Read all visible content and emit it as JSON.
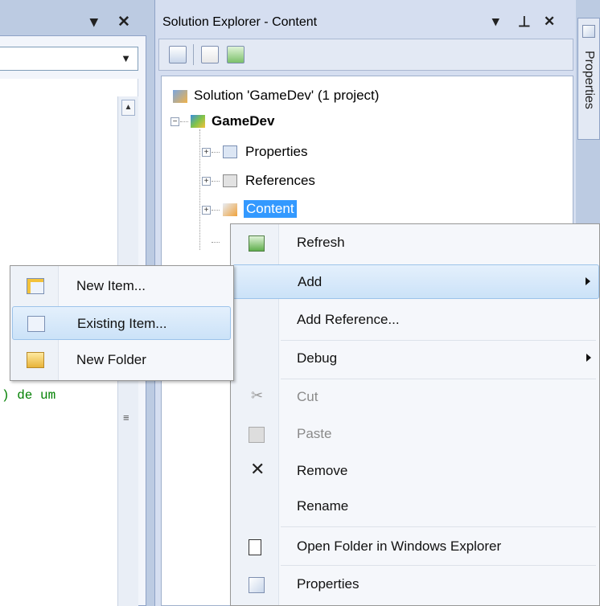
{
  "left_panel": {
    "dropdown_icon": "chevron-down-icon",
    "close_icon": "close-icon",
    "code_fragment": ") de um"
  },
  "solution_explorer": {
    "title": "Solution Explorer - Content",
    "toolbar": [
      "properties-icon",
      "show-all-files-icon",
      "refresh-icon"
    ],
    "tree": {
      "solution": "Solution 'GameDev' (1 project)",
      "project": "GameDev",
      "children": [
        "Properties",
        "References",
        "Content"
      ],
      "selected": "Content"
    }
  },
  "properties_tab": {
    "label": "Properties"
  },
  "context_menu": {
    "items": [
      {
        "label": "Refresh",
        "icon": "refresh-icon",
        "enabled": true
      },
      {
        "label": "Add",
        "submenu": true,
        "highlighted": true
      },
      {
        "label": "Add Reference..."
      },
      {
        "label": "Debug",
        "submenu": true
      },
      {
        "label": "Cut",
        "icon": "cut-icon",
        "enabled": false
      },
      {
        "label": "Paste",
        "icon": "paste-icon",
        "enabled": false
      },
      {
        "label": "Remove",
        "icon": "remove-icon",
        "enabled": true
      },
      {
        "label": "Rename"
      },
      {
        "label": "Open Folder in Windows Explorer",
        "icon": "open-folder-icon"
      },
      {
        "label": "Properties",
        "icon": "properties-icon"
      }
    ]
  },
  "add_submenu": {
    "items": [
      {
        "label": "New Item...",
        "icon": "new-item-icon"
      },
      {
        "label": "Existing Item...",
        "icon": "existing-item-icon",
        "highlighted": true
      },
      {
        "label": "New Folder",
        "icon": "new-folder-icon"
      }
    ]
  },
  "colors": {
    "selection": "#3399ff",
    "highlight": "#cbe2f8",
    "panel": "#bccbe2",
    "code_green": "#008000"
  }
}
